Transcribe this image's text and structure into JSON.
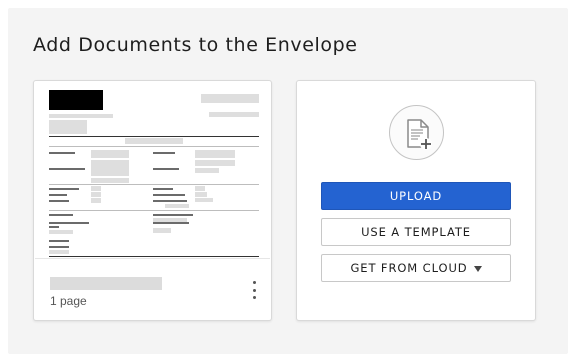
{
  "panel": {
    "title": "Add Documents to the Envelope"
  },
  "document": {
    "page_count": "1 page",
    "icons": {
      "more": "more-vertical-icon"
    }
  },
  "upload_card": {
    "icon": "document-add-icon",
    "upload_label": "UPLOAD",
    "template_label": "USE A TEMPLATE",
    "cloud_label": "GET FROM CLOUD",
    "cloud_caret_icon": "caret-down-icon"
  },
  "colors": {
    "primary": "#2463d1",
    "panel_bg": "#f4f4f4",
    "card_border": "#d9d9d9"
  }
}
